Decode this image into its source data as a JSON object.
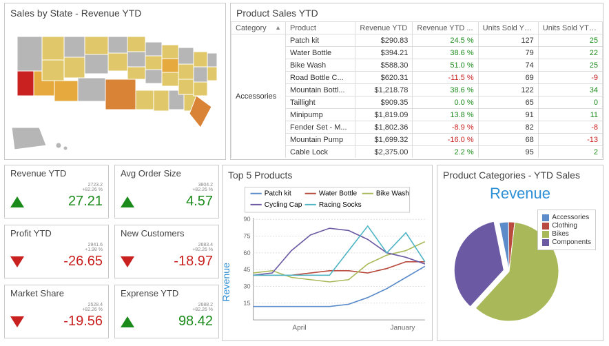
{
  "map": {
    "title": "Sales by State - Revenue YTD"
  },
  "table": {
    "title": "Product Sales YTD",
    "columns": [
      "Category",
      "Product",
      "Revenue YTD",
      "Revenue YTD ...",
      "Units Sold YTD",
      "Units Sold YTD ..."
    ],
    "category": "Accessories",
    "rows": [
      {
        "product": "Patch kit",
        "revenue": "$290.83",
        "rev_pct": "24.5 %",
        "rev_sign": "pos",
        "units": "127",
        "units_pct": "25",
        "units_sign": "pos"
      },
      {
        "product": "Water Bottle",
        "revenue": "$394.21",
        "rev_pct": "38.6 %",
        "rev_sign": "pos",
        "units": "79",
        "units_pct": "22",
        "units_sign": "pos"
      },
      {
        "product": "Bike Wash",
        "revenue": "$588.30",
        "rev_pct": "51.0 %",
        "rev_sign": "pos",
        "units": "74",
        "units_pct": "25",
        "units_sign": "pos"
      },
      {
        "product": "Road Bottle C...",
        "revenue": "$620.31",
        "rev_pct": "-11.5 %",
        "rev_sign": "neg",
        "units": "69",
        "units_pct": "-9",
        "units_sign": "neg"
      },
      {
        "product": "Mountain Bottl...",
        "revenue": "$1,218.78",
        "rev_pct": "38.6 %",
        "rev_sign": "pos",
        "units": "122",
        "units_pct": "34",
        "units_sign": "pos"
      },
      {
        "product": "Taillight",
        "revenue": "$909.35",
        "rev_pct": "0.0 %",
        "rev_sign": "pos",
        "units": "65",
        "units_pct": "0",
        "units_sign": "pos"
      },
      {
        "product": "Minipump",
        "revenue": "$1,819.09",
        "rev_pct": "13.8 %",
        "rev_sign": "pos",
        "units": "91",
        "units_pct": "11",
        "units_sign": "pos"
      },
      {
        "product": "Fender Set - M...",
        "revenue": "$1,802.36",
        "rev_pct": "-8.9 %",
        "rev_sign": "neg",
        "units": "82",
        "units_pct": "-8",
        "units_sign": "neg"
      },
      {
        "product": "Mountain Pump",
        "revenue": "$1,699.32",
        "rev_pct": "-16.0 %",
        "rev_sign": "neg",
        "units": "68",
        "units_pct": "-13",
        "units_sign": "neg"
      },
      {
        "product": "Cable Lock",
        "revenue": "$2,375.00",
        "rev_pct": "2.2 %",
        "rev_sign": "pos",
        "units": "95",
        "units_pct": "2",
        "units_sign": "pos"
      }
    ]
  },
  "kpis": [
    {
      "title": "Revenue YTD",
      "value": "27.21",
      "dir": "up",
      "small1": "2723.2",
      "small2": "+82.26 %"
    },
    {
      "title": "Avg Order Size",
      "value": "4.57",
      "dir": "up",
      "small1": "3804.2",
      "small2": "+82.26 %"
    },
    {
      "title": "Profit YTD",
      "value": "-26.65",
      "dir": "down",
      "small1": "2941.6",
      "small2": "+1.98 %"
    },
    {
      "title": "New Customers",
      "value": "-18.97",
      "dir": "down",
      "small1": "2683.4",
      "small2": "+82.26 %"
    },
    {
      "title": "Market Share",
      "value": "-19.56",
      "dir": "down",
      "small1": "2528.4",
      "small2": "+82.26 %"
    },
    {
      "title": "Exprense YTD",
      "value": "98.42",
      "dir": "up",
      "small1": "2688.2",
      "small2": "+82.26 %"
    }
  ],
  "line": {
    "title": "Top 5 Products",
    "ylabel": "Revenue",
    "series_names": [
      "Patch kit",
      "Water Bottle",
      "Bike Wash",
      "Cycling Cap",
      "Racing Socks"
    ],
    "colors": [
      "#5b8bc9",
      "#b84a3e",
      "#a9b959",
      "#6b5aa3",
      "#4fb5c4"
    ],
    "xticks": [
      "April",
      "January"
    ]
  },
  "pie": {
    "title": "Product Categories - YTD Sales",
    "center_label": "Revenue",
    "legend": [
      "Accessories",
      "Clothing",
      "Bikes",
      "Components"
    ],
    "colors": [
      "#5b8bc9",
      "#b84a3e",
      "#a9b959",
      "#6b5aa3"
    ]
  },
  "chart_data": [
    {
      "type": "line",
      "title": "Top 5 Products",
      "ylabel": "Revenue",
      "ylim": [
        0,
        90
      ],
      "x": [
        1,
        2,
        3,
        4,
        5,
        6,
        7,
        8,
        9,
        10
      ],
      "series": [
        {
          "name": "Patch kit",
          "values": [
            12,
            12,
            12,
            12,
            12,
            14,
            20,
            28,
            38,
            48
          ]
        },
        {
          "name": "Water Bottle",
          "values": [
            40,
            40,
            40,
            42,
            44,
            44,
            42,
            46,
            52,
            52
          ]
        },
        {
          "name": "Bike Wash",
          "values": [
            42,
            44,
            38,
            36,
            34,
            36,
            50,
            58,
            62,
            70
          ]
        },
        {
          "name": "Cycling Cap",
          "values": [
            40,
            42,
            62,
            76,
            82,
            80,
            72,
            60,
            56,
            50
          ]
        },
        {
          "name": "Racing Socks",
          "values": [
            40,
            40,
            40,
            40,
            40,
            62,
            84,
            60,
            78,
            52
          ]
        }
      ],
      "xtick_labels_shown": [
        "April",
        "January"
      ]
    },
    {
      "type": "pie",
      "title": "Product Categories - YTD Sales",
      "slices": [
        {
          "name": "Accessories",
          "value": 3
        },
        {
          "name": "Clothing",
          "value": 2
        },
        {
          "name": "Bikes",
          "value": 60
        },
        {
          "name": "Components",
          "value": 35
        }
      ]
    }
  ]
}
